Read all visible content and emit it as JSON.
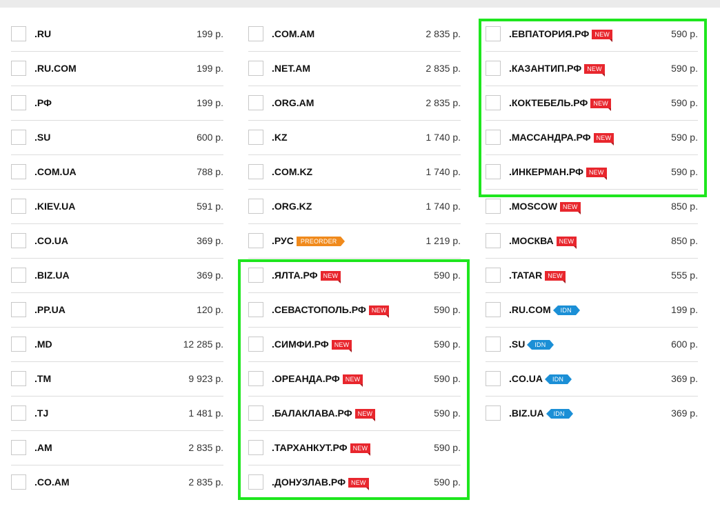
{
  "highlight_color": "#1ee61e",
  "columns": [
    {
      "rows": [
        {
          "zone": ".RU",
          "price": "199 р."
        },
        {
          "zone": ".RU.COM",
          "price": "199 р."
        },
        {
          "zone": ".РФ",
          "price": "199 р."
        },
        {
          "zone": ".SU",
          "price": "600 р."
        },
        {
          "zone": ".COM.UA",
          "price": "788 р."
        },
        {
          "zone": ".KIEV.UA",
          "price": "591 р."
        },
        {
          "zone": ".CO.UA",
          "price": "369 р."
        },
        {
          "zone": ".BIZ.UA",
          "price": "369 р."
        },
        {
          "zone": ".PP.UA",
          "price": "120 р."
        },
        {
          "zone": ".MD",
          "price": "12 285 р."
        },
        {
          "zone": ".TM",
          "price": "9 923 р."
        },
        {
          "zone": ".TJ",
          "price": "1 481 р."
        },
        {
          "zone": ".AM",
          "price": "2 835 р."
        },
        {
          "zone": ".CO.AM",
          "price": "2 835 р."
        }
      ]
    },
    {
      "rows": [
        {
          "zone": ".COM.AM",
          "price": "2 835 р."
        },
        {
          "zone": ".NET.AM",
          "price": "2 835 р."
        },
        {
          "zone": ".ORG.AM",
          "price": "2 835 р."
        },
        {
          "zone": ".KZ",
          "price": "1 740 р."
        },
        {
          "zone": ".COM.KZ",
          "price": "1 740 р."
        },
        {
          "zone": ".ORG.KZ",
          "price": "1 740 р."
        },
        {
          "zone": ".РУС",
          "price": "1 219 р.",
          "badge": "PREORDER",
          "badge_type": "preorder"
        },
        {
          "zone": ".ЯЛТА.РФ",
          "price": "590 р.",
          "badge": "NEW",
          "badge_type": "new"
        },
        {
          "zone": ".СЕВАСТОПОЛЬ.РФ",
          "price": "590 р.",
          "badge": "NEW",
          "badge_type": "new"
        },
        {
          "zone": ".СИМФИ.РФ",
          "price": "590 р.",
          "badge": "NEW",
          "badge_type": "new"
        },
        {
          "zone": ".ОРЕАНДА.РФ",
          "price": "590 р.",
          "badge": "NEW",
          "badge_type": "new"
        },
        {
          "zone": ".БАЛАКЛАВА.РФ",
          "price": "590 р.",
          "badge": "NEW",
          "badge_type": "new"
        },
        {
          "zone": ".ТАРХАНКУТ.РФ",
          "price": "590 р.",
          "badge": "NEW",
          "badge_type": "new"
        },
        {
          "zone": ".ДОНУЗЛАВ.РФ",
          "price": "590 р.",
          "badge": "NEW",
          "badge_type": "new"
        }
      ]
    },
    {
      "rows": [
        {
          "zone": ".ЕВПАТОРИЯ.РФ",
          "price": "590 р.",
          "badge": "NEW",
          "badge_type": "new"
        },
        {
          "zone": ".КАЗАНТИП.РФ",
          "price": "590 р.",
          "badge": "NEW",
          "badge_type": "new"
        },
        {
          "zone": ".КОКТЕБЕЛЬ.РФ",
          "price": "590 р.",
          "badge": "NEW",
          "badge_type": "new"
        },
        {
          "zone": ".МАССАНДРА.РФ",
          "price": "590 р.",
          "badge": "NEW",
          "badge_type": "new"
        },
        {
          "zone": ".ИНКЕРМАН.РФ",
          "price": "590 р.",
          "badge": "NEW",
          "badge_type": "new"
        },
        {
          "zone": ".MOSCOW",
          "price": "850 р.",
          "badge": "NEW",
          "badge_type": "new"
        },
        {
          "zone": ".МОСКВА",
          "price": "850 р.",
          "badge": "NEW",
          "badge_type": "new"
        },
        {
          "zone": ".TATAR",
          "price": "555 р.",
          "badge": "NEW",
          "badge_type": "new"
        },
        {
          "zone": ".RU.COM",
          "price": "199 р.",
          "badge": "IDN",
          "badge_type": "idn"
        },
        {
          "zone": ".SU",
          "price": "600 р.",
          "badge": "IDN",
          "badge_type": "idn"
        },
        {
          "zone": ".CO.UA",
          "price": "369 р.",
          "badge": "IDN",
          "badge_type": "idn"
        },
        {
          "zone": ".BIZ.UA",
          "price": "369 р.",
          "badge": "IDN",
          "badge_type": "idn"
        }
      ]
    }
  ]
}
